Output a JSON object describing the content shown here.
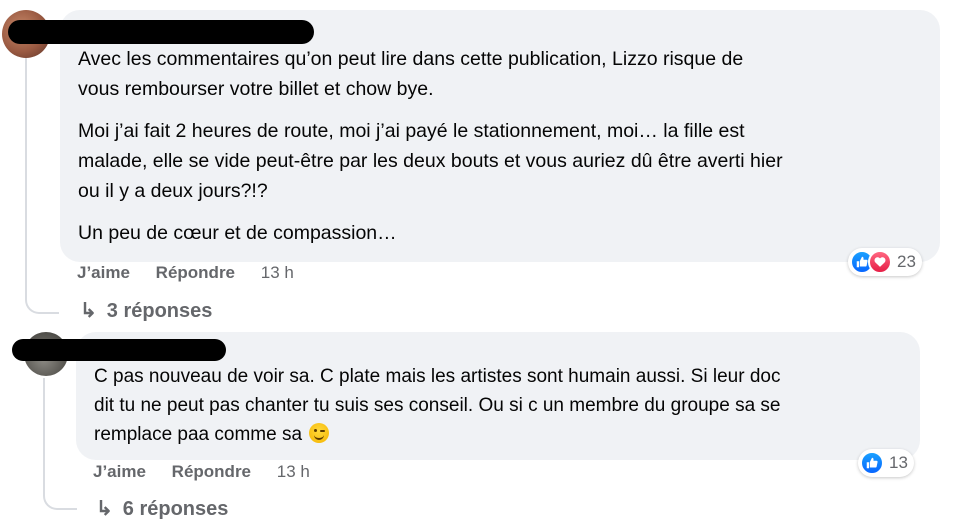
{
  "comments": [
    {
      "paragraphs": [
        "Avec les commentaires qu’on peut lire dans cette publication, Lizzo risque de\nvous rembourser votre billet et chow bye.",
        "Moi j’ai fait 2 heures de route, moi j’ai payé le stationnement, moi… la fille est\nmalade, elle se vide peut-être par les deux bouts et vous auriez dû être averti hier\nou il y a deux jours?!?",
        "Un peu de cœur et de compassion…"
      ],
      "like_label": "J’aime",
      "reply_label": "Répondre",
      "time": "13 h",
      "reaction_count": "23",
      "reaction_icons": [
        "like-icon",
        "love-icon"
      ],
      "replies_label": "3 réponses"
    },
    {
      "text": "C pas nouveau de voir sa. C plate mais les artistes sont humain aussi. Si leur doc\ndit tu ne peut pas chanter tu suis ses conseil. Ou si c un membre du groupe sa se\nremplace paa comme sa",
      "emoji": "winking-face-emoji",
      "like_label": "J’aime",
      "reply_label": "Répondre",
      "time": "13 h",
      "reaction_count": "13",
      "reaction_icons": [
        "like-icon"
      ],
      "replies_label": "6 réponses"
    }
  ],
  "colors": {
    "bubble": "#f0f2f5",
    "secondary_text": "#65676b",
    "like": "#0866ff",
    "love": "#e61e46"
  }
}
